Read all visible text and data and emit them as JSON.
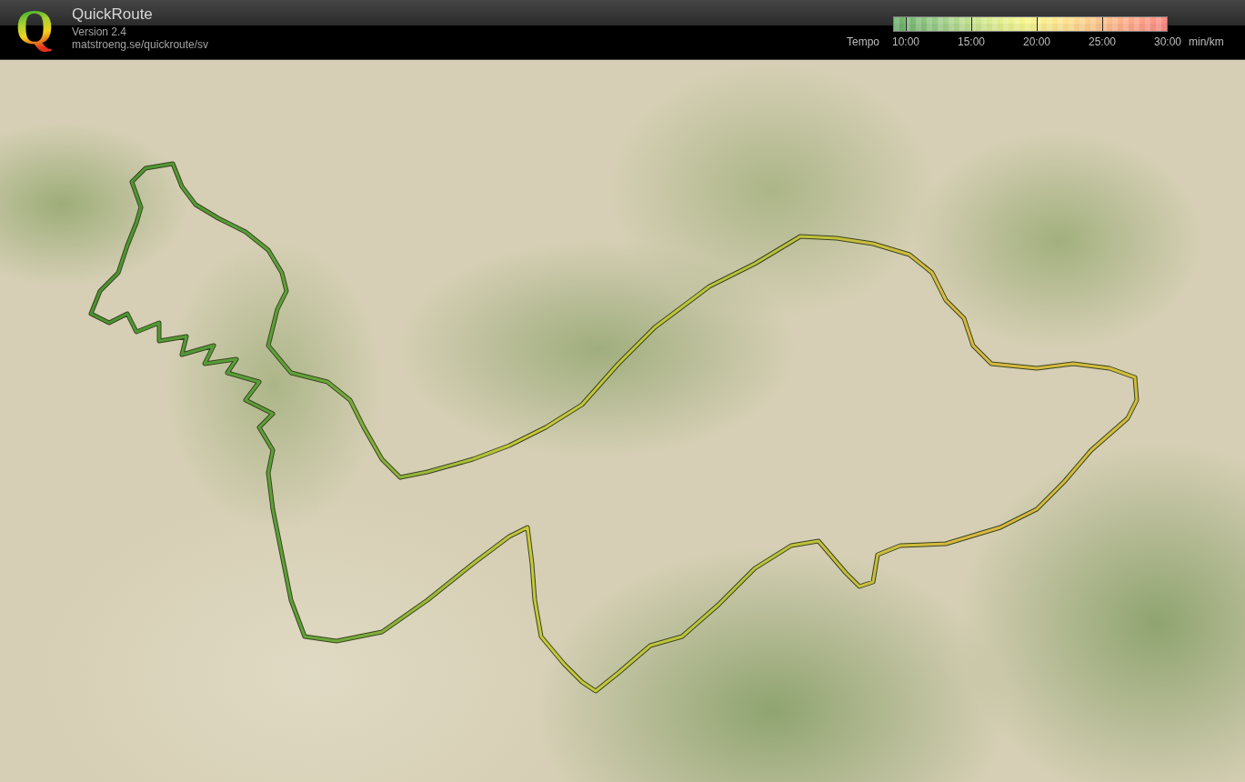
{
  "header": {
    "logo": "Q",
    "title": "QuickRoute",
    "version": "Version 2.4",
    "url": "matstroeng.se/quickroute/sv"
  },
  "tempo_scale": {
    "label": "Tempo",
    "ticks": [
      "10:00",
      "15:00",
      "20:00",
      "25:00",
      "30:00"
    ],
    "unit": "min/km"
  }
}
